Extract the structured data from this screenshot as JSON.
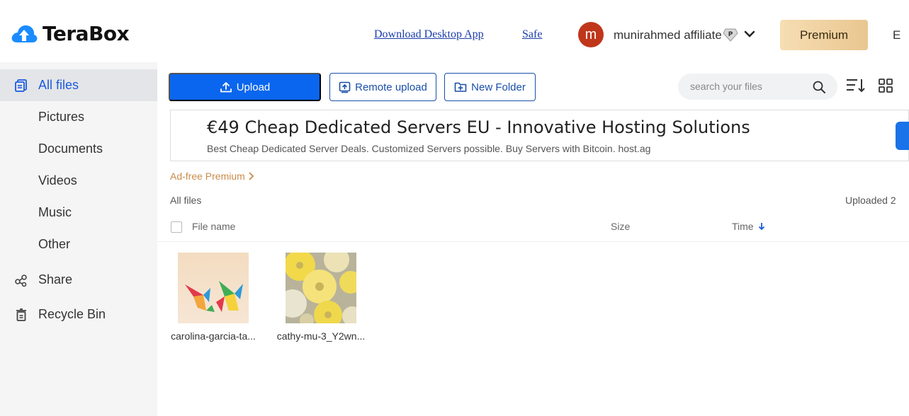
{
  "header": {
    "brand": "TeraBox",
    "download_link": "Download Desktop App",
    "safe_link": "Safe",
    "avatar_letter": "m",
    "username": "munirahmed affiliate",
    "premium_label": "Premium",
    "lang_partial": "E",
    "colors": {
      "brand_blue": "#1a73e8",
      "avatar": "#c0361a",
      "premium_gold": "#e9c690"
    }
  },
  "sidebar": {
    "items": [
      {
        "label": "All files",
        "icon": "file-stack-icon",
        "active": true
      },
      {
        "label": "Pictures"
      },
      {
        "label": "Documents"
      },
      {
        "label": "Videos"
      },
      {
        "label": "Music"
      },
      {
        "label": "Other"
      },
      {
        "label": "Share",
        "icon": "share-icon"
      },
      {
        "label": "Recycle Bin",
        "icon": "trash-icon"
      }
    ]
  },
  "toolbar": {
    "upload_label": "Upload",
    "remote_upload_label": "Remote upload",
    "new_folder_label": "New Folder",
    "search_placeholder": "search your files"
  },
  "ad": {
    "title": "€49 Cheap Dedicated Servers EU - Innovative Hosting Solutions",
    "subtitle": "Best Cheap Dedicated Server Deals. Customized Servers possible. Buy Servers with Bitcoin. host.ag"
  },
  "main": {
    "adfree_label": "Ad-free Premium",
    "breadcrumb": "All files",
    "uploaded_label": "Uploaded 2",
    "columns": {
      "name": "File name",
      "size": "Size",
      "time": "Time"
    },
    "files": [
      {
        "name": "carolina-garcia-ta..."
      },
      {
        "name": "cathy-mu-3_Y2wn..."
      }
    ]
  }
}
